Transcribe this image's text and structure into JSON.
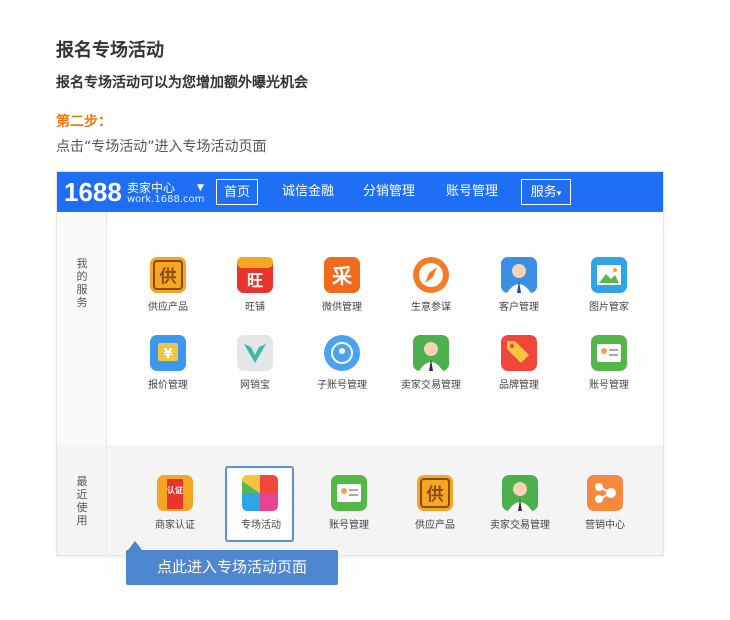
{
  "page": {
    "title": "报名专场活动",
    "subtitle": "报名专场活动可以为您增加额外曝光机会",
    "step": "第二步：",
    "description": "点击“专场活动”进入专场活动页面"
  },
  "topbar": {
    "logo_number": "1688",
    "logo_title": "卖家中心",
    "logo_url": "work.1688.com",
    "nav": [
      "首页",
      "诚信金融",
      "分销管理",
      "账号管理",
      "服务"
    ],
    "service_caret": "▾"
  },
  "my_services": {
    "section_label": "我的服务",
    "items": [
      {
        "label": "供应产品",
        "icon": "supply-icon",
        "glyph": "供"
      },
      {
        "label": "旺铺",
        "icon": "wangpu-icon",
        "glyph": "旺"
      },
      {
        "label": "微供管理",
        "icon": "weigong-icon",
        "glyph": "采"
      },
      {
        "label": "生意参谋",
        "icon": "compass-icon",
        "glyph": ""
      },
      {
        "label": "客户管理",
        "icon": "customer-icon",
        "glyph": ""
      },
      {
        "label": "图片管家",
        "icon": "picture-icon",
        "glyph": ""
      },
      {
        "label": "报价管理",
        "icon": "quote-icon",
        "glyph": "¥"
      },
      {
        "label": "网销宝",
        "icon": "wangxiaobao-icon",
        "glyph": ""
      },
      {
        "label": "子账号管理",
        "icon": "subaccount-icon",
        "glyph": ""
      },
      {
        "label": "卖家交易管理",
        "icon": "seller-trade-icon",
        "glyph": ""
      },
      {
        "label": "品牌管理",
        "icon": "brand-icon",
        "glyph": ""
      },
      {
        "label": "账号管理",
        "icon": "account-card-icon",
        "glyph": ""
      }
    ]
  },
  "recent": {
    "section_label": "最近使用",
    "items": [
      {
        "label": "商家认证",
        "icon": "certify-icon",
        "glyph": "认证"
      },
      {
        "label": "专场活动",
        "icon": "special-event-icon",
        "glyph": ""
      },
      {
        "label": "账号管理",
        "icon": "account-card-icon",
        "glyph": ""
      },
      {
        "label": "供应产品",
        "icon": "supply-icon",
        "glyph": "供"
      },
      {
        "label": "卖家交易管理",
        "icon": "seller-trade-icon",
        "glyph": ""
      },
      {
        "label": "营销中心",
        "icon": "marketing-icon",
        "glyph": ""
      }
    ]
  },
  "callout": {
    "text": "点此进入专场活动页面"
  },
  "colors": {
    "topbar": "#1e6ff5",
    "step": "#f07a0b",
    "callout": "#4f86d0"
  }
}
